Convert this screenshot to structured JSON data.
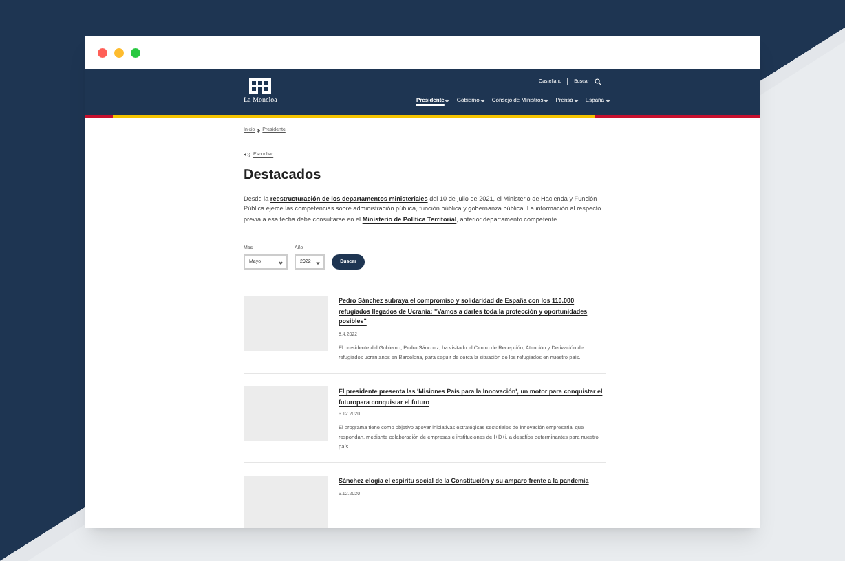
{
  "header": {
    "logo_text": "La Moncloa",
    "language": "Castellano",
    "search": "Buscar",
    "nav": [
      {
        "label": "Presidente",
        "selected": true
      },
      {
        "label": "Gobierno",
        "selected": false
      },
      {
        "label": "Consejo de Ministros",
        "selected": false
      },
      {
        "label": "Prensa",
        "selected": false
      },
      {
        "label": "España",
        "selected": false
      }
    ]
  },
  "breadcrumb": [
    "Inicio",
    "Presidente"
  ],
  "listen": "Escuchar",
  "title": "Destacados",
  "intro": [
    {
      "kind": "text",
      "text": "Desde la "
    },
    {
      "kind": "link",
      "text": "reestructuración de los departamentos ministeriales"
    },
    {
      "kind": "text",
      "text": " del 10 de julio de 2021, el Ministerio de Hacienda y Función Pública ejerce las competencias sobre administración pública, función pública y gobernanza pública. La información al respecto previa a esa fecha debe consultarse en el "
    },
    {
      "kind": "link",
      "text": "Ministerio de Política Territorial"
    },
    {
      "kind": "text",
      "text": ", anterior departamento competente."
    }
  ],
  "filter": {
    "month_label": "Mes",
    "month": "Mayo",
    "year_label": "Año",
    "year": "2022",
    "button": "Buscar"
  },
  "articles": [
    {
      "title": "Pedro Sánchez subraya el compromiso y solidaridad de España con los 110.000 refugiados llegados de Ucrania: \"Vamos a darles toda la protección y oportunidades posibles\"",
      "date": "8.4.2022",
      "summary": "El presidente del Gobierno, Pedro Sánchez, ha visitado el Centro de Recepción, Atención y Derivación de refugiados ucranianos en Barcelona, para seguir de cerca la situación de los refugiados en nuestro país."
    },
    {
      "title": "El presidente presenta las 'Misiones País para la Innovación', un motor para conquistar el futuropara conquistar el futuro",
      "date": "6.12.2020",
      "summary": "El programa tiene como objetivo apoyar iniciativas estratégicas sectoriales de innovación empresarial que respondan, mediante colaboración de empresas e instituciones de I+D+i, a desafíos determinantes para nuestro país."
    },
    {
      "title": "Sánchez elogia el espíritu social de la Constitución y su amparo frente a la pandemia",
      "date": "6.12.2020"
    }
  ]
}
